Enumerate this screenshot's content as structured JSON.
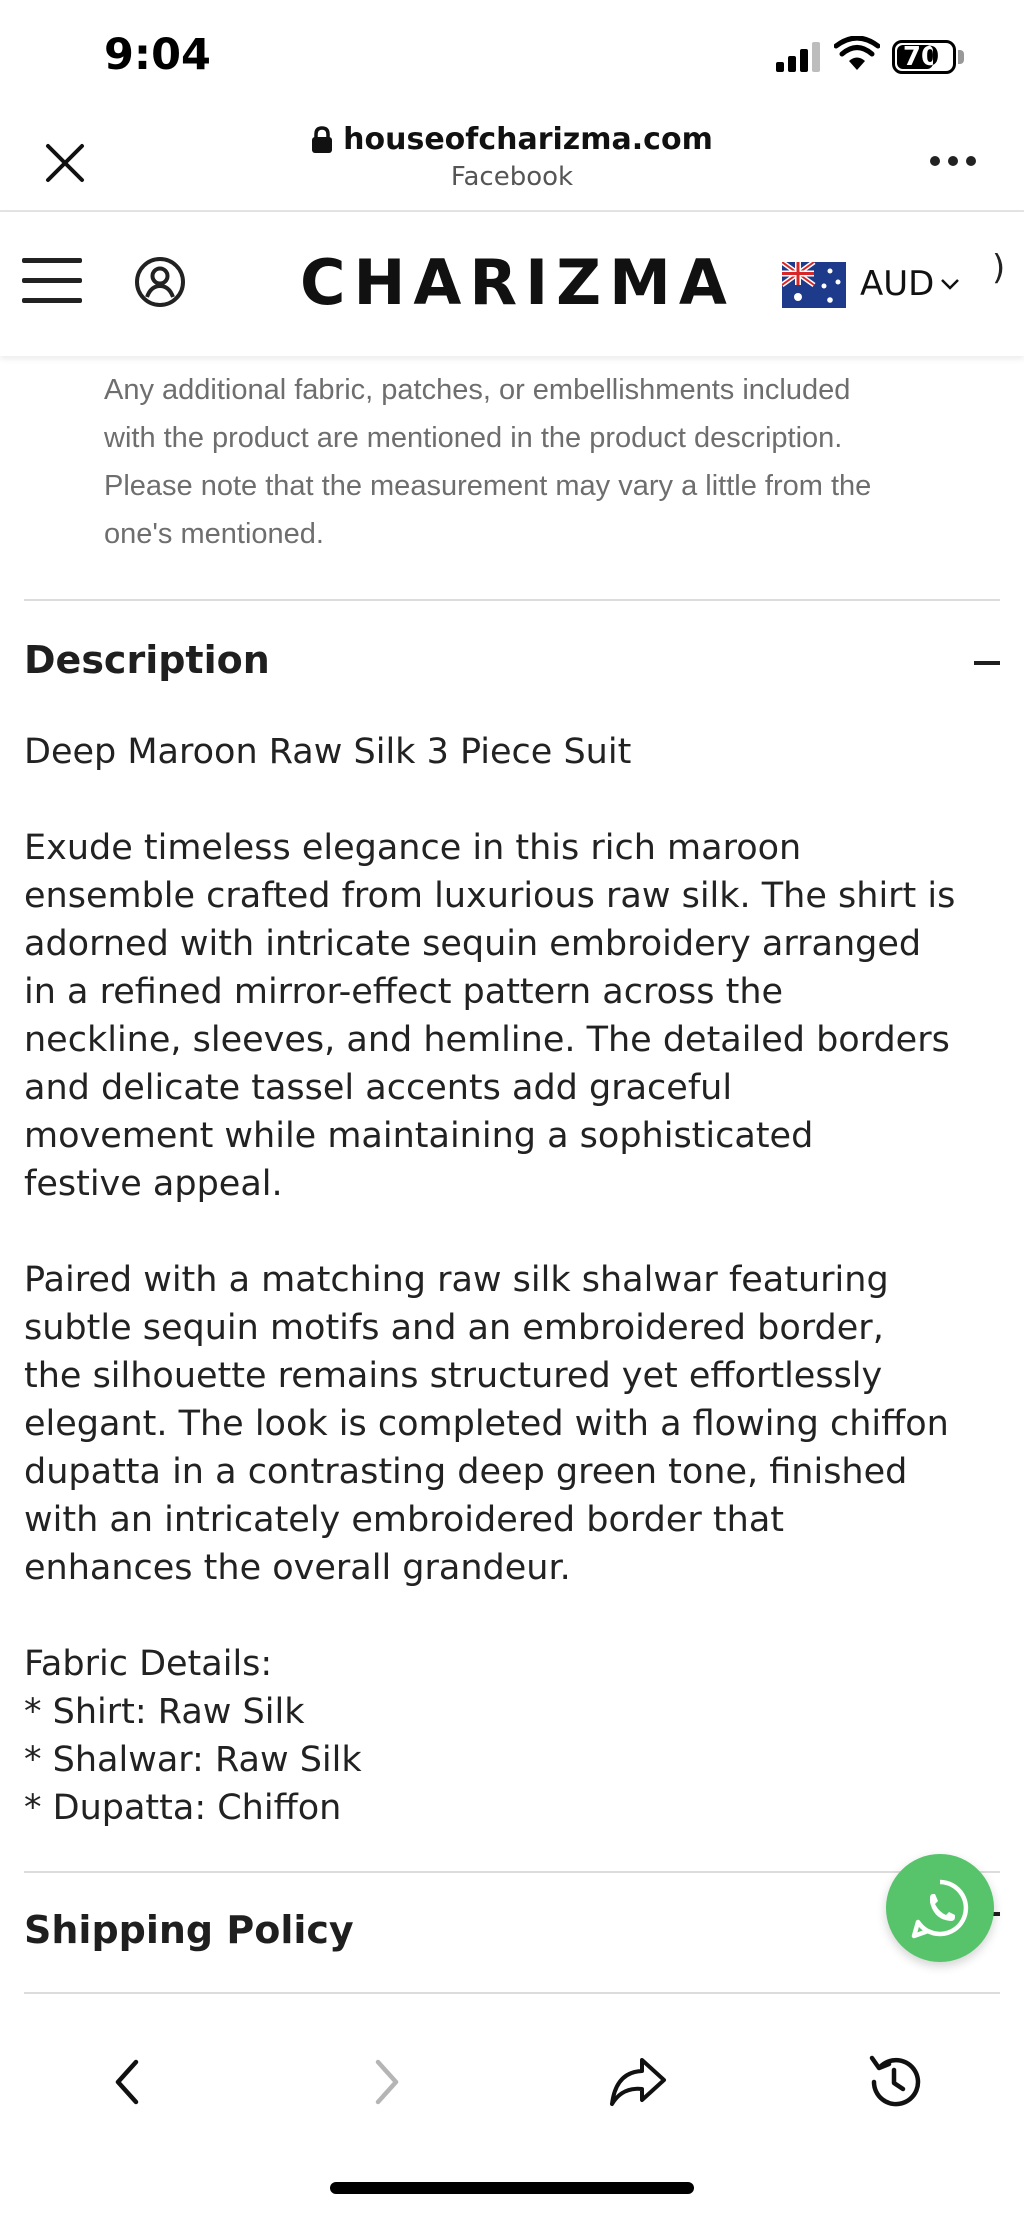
{
  "status_bar": {
    "time": "9:04",
    "battery": "70",
    "battery_level_percent": 70
  },
  "browser": {
    "url": "houseofcharizma.com",
    "source": "Facebook",
    "icons": [
      "close-icon",
      "lock-icon",
      "more-icon"
    ]
  },
  "site_header": {
    "logo": "CHARIZMA",
    "currency": "AUD",
    "icons": [
      "menu-icon",
      "account-icon",
      "australia-flag-icon",
      "chevron-down-icon"
    ]
  },
  "note": {
    "lines": [
      "Any additional fabric, patches, or embellishments included",
      "with the product are mentioned in the product description.",
      "Please note that the measurement may vary a little from the",
      "one's mentioned."
    ]
  },
  "description": {
    "heading": "Description",
    "product_name": "Deep Maroon Raw Silk 3 Piece Suit",
    "paragraph_1": [
      "Exude timeless elegance in this rich maroon",
      "ensemble crafted from luxurious raw silk. The shirt is",
      "adorned with intricate sequin embroidery arranged",
      "in a refined mirror-effect pattern across the",
      "neckline, sleeves, and hemline. The detailed borders",
      "and delicate tassel accents add graceful",
      "movement while maintaining a sophisticated",
      "festive appeal."
    ],
    "paragraph_2": [
      "Paired with a matching raw silk shalwar featuring",
      "subtle sequin motifs and an embroidered border,",
      "the silhouette remains structured yet effortlessly",
      "elegant. The look is completed with a flowing chiffon",
      "dupatta in a contrasting deep green tone, finished",
      "with an intricately embroidered border that",
      "enhances the overall grandeur."
    ],
    "fabric_heading": "Fabric Details:",
    "fabric_items": [
      "* Shirt: Raw Silk",
      "* Shalwar: Raw Silk",
      "* Dupatta: Chiffon"
    ]
  },
  "shipping": {
    "heading": "Shipping Policy"
  },
  "colors": {
    "whatsapp_green": "#57c46b",
    "note_gray": "#6e6e6e",
    "divider": "#dcdcdc"
  },
  "bottom_bar": {
    "icons": [
      "back-icon",
      "forward-icon",
      "share-icon",
      "history-icon"
    ]
  }
}
